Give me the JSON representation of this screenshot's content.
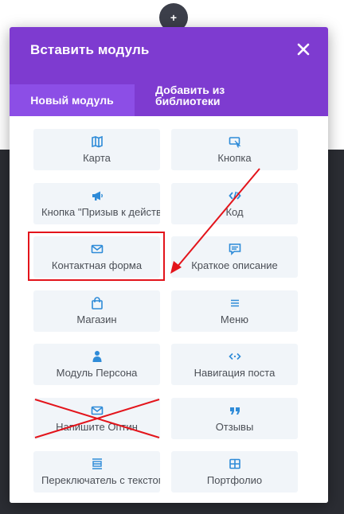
{
  "fab": {
    "label": "+"
  },
  "modal": {
    "title": "Вставить модуль",
    "close_icon": "close-icon",
    "tabs": [
      {
        "label": "Новый модуль",
        "active": true
      },
      {
        "label": "Добавить из библиотеки",
        "active": false
      }
    ]
  },
  "modules": [
    {
      "label": "Карта",
      "icon": "map-icon"
    },
    {
      "label": "Кнопка",
      "icon": "cursor-button-icon"
    },
    {
      "label": "Кнопка \"Призыв к действию\"",
      "icon": "megaphone-icon"
    },
    {
      "label": "Код",
      "icon": "code-icon"
    },
    {
      "label": "Контактная форма",
      "icon": "envelope-icon",
      "highlighted": true
    },
    {
      "label": "Краткое описание",
      "icon": "speech-bubble-icon"
    },
    {
      "label": "Магазин",
      "icon": "shopping-bag-icon"
    },
    {
      "label": "Меню",
      "icon": "menu-lines-icon"
    },
    {
      "label": "Модуль Персона",
      "icon": "person-icon"
    },
    {
      "label": "Навигация поста",
      "icon": "post-navigation-icon"
    },
    {
      "label": "Напишите Оптин",
      "icon": "envelope-icon",
      "crossed_out": true
    },
    {
      "label": "Отзывы",
      "icon": "quote-icon"
    },
    {
      "label": "Переключатель с текстом",
      "icon": "toggle-icon"
    },
    {
      "label": "Портфолио",
      "icon": "grid-icon"
    }
  ],
  "colors": {
    "accent_purple": "#7e3bd0",
    "active_tab": "#8c4ee6",
    "module_bg": "#f1f5f9",
    "icon_blue": "#2e8bd8",
    "annotation_red": "#e3141b"
  }
}
